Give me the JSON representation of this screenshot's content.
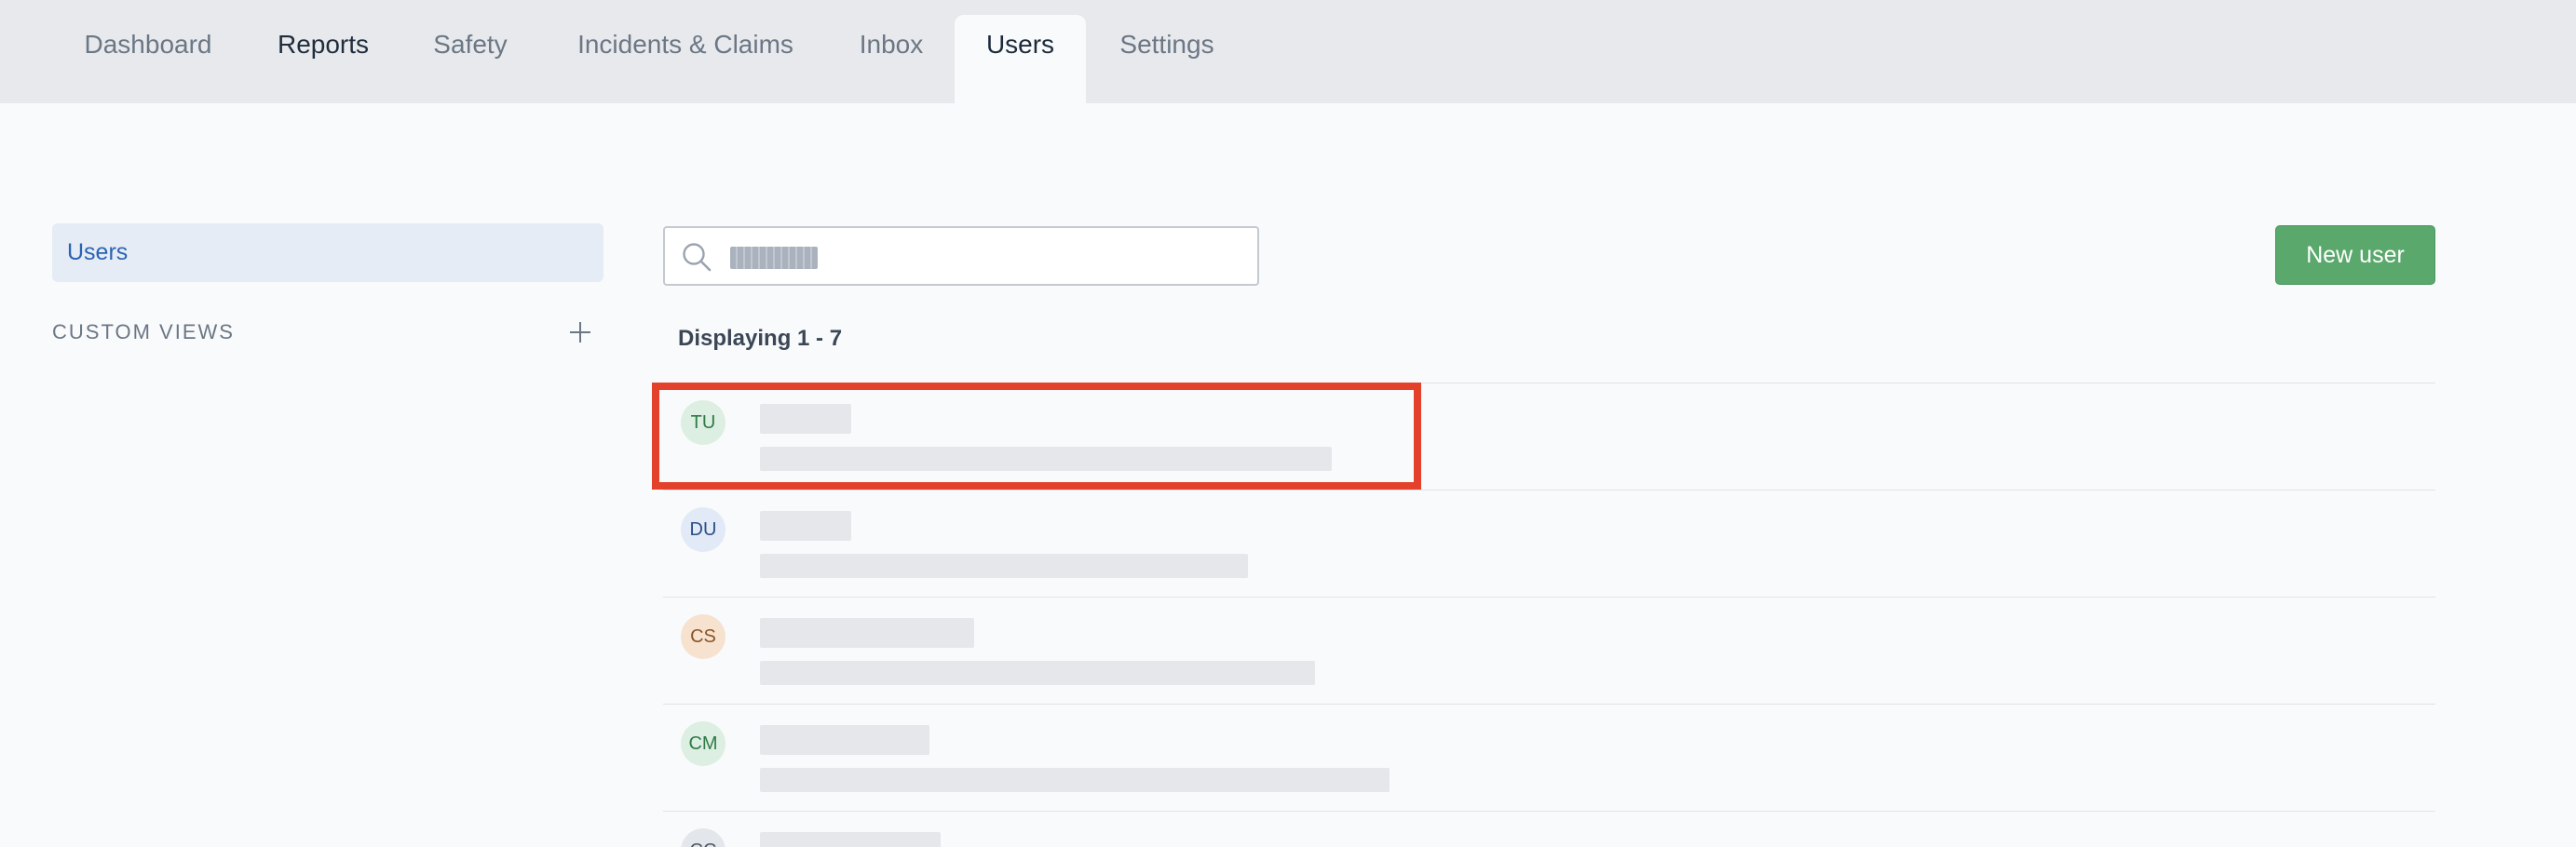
{
  "nav": {
    "tabs": [
      {
        "label": "Dashboard"
      },
      {
        "label": "Reports"
      },
      {
        "label": "Safety"
      },
      {
        "label": "Incidents & Claims"
      },
      {
        "label": "Inbox"
      },
      {
        "label": "Users"
      },
      {
        "label": "Settings"
      }
    ],
    "active": "Users"
  },
  "sidebar": {
    "users_label": "Users",
    "custom_views_label": "CUSTOM VIEWS"
  },
  "search": {
    "placeholder": ""
  },
  "actions": {
    "new_user_label": "New user"
  },
  "list": {
    "displaying_label": "Displaying 1 - 7",
    "users": [
      {
        "initials": "TU",
        "avatar_bg": "#dcefe2",
        "avatar_fg": "#2f7a45"
      },
      {
        "initials": "DU",
        "avatar_bg": "#e2eaf7",
        "avatar_fg": "#2c4f86"
      },
      {
        "initials": "CS",
        "avatar_bg": "#f6e2cf",
        "avatar_fg": "#8a5426"
      },
      {
        "initials": "CM",
        "avatar_bg": "#dcefe2",
        "avatar_fg": "#2f7a45"
      },
      {
        "initials": "CC",
        "avatar_bg": "#e3e6ea",
        "avatar_fg": "#4a5563"
      }
    ]
  },
  "colors": {
    "accent_blue": "#2a63b4",
    "primary_green": "#5aa86c",
    "highlight_red": "#e3412b"
  }
}
